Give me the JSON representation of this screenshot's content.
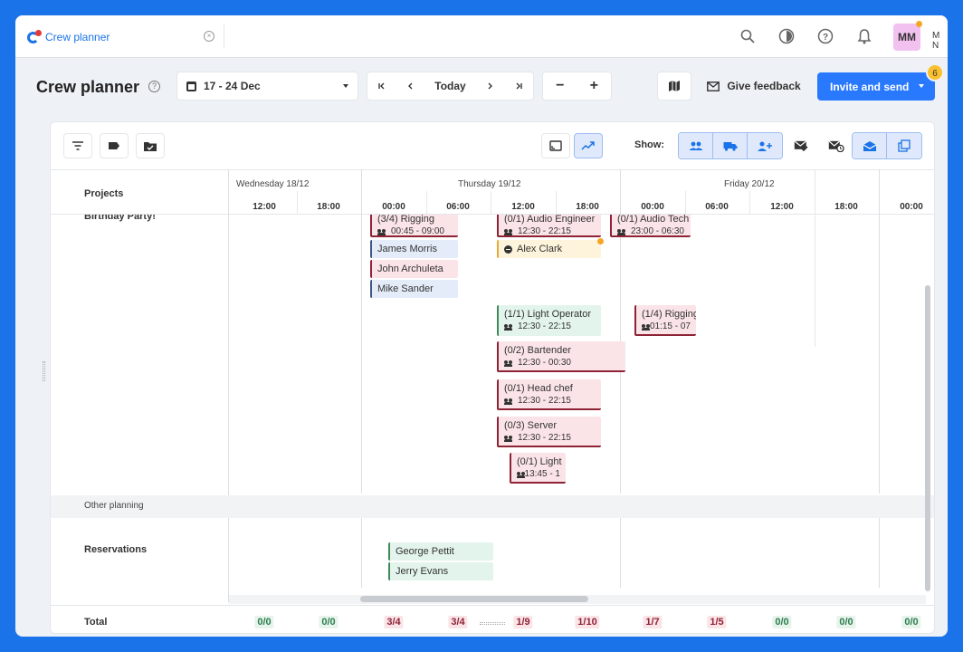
{
  "tab": {
    "title": "Crew planner"
  },
  "user": {
    "initials": "MM",
    "name": "M N"
  },
  "header": {
    "title": "Crew planner",
    "date_range": "17 - 24 Dec",
    "today": "Today",
    "minus": "−",
    "plus": "+",
    "feedback": "Give feedback",
    "invite": "Invite and send",
    "badge": "6"
  },
  "toolbar": {
    "show_label": "Show:"
  },
  "grid": {
    "projects_header": "Projects",
    "days": [
      "Wednesday 18/12",
      "Thursday 19/12",
      "Friday 20/12"
    ],
    "times": [
      "12:00",
      "18:00",
      "00:00",
      "06:00",
      "12:00",
      "18:00",
      "00:00",
      "06:00",
      "12:00",
      "18:00",
      "00:00"
    ]
  },
  "projects": {
    "birthday": "Birthday Party!",
    "other_planning": "Other planning",
    "reservations": "Reservations"
  },
  "cards": {
    "rigging1": {
      "title": "(3/4) Rigging",
      "time": "00:45 - 09:00"
    },
    "audio_engineer": {
      "title": "(0/1) Audio Engineer",
      "time": "12:30 - 22:15"
    },
    "audio_tech": {
      "title": "(0/1) Audio Tech",
      "time": "23:00 - 06:30"
    },
    "james": "James Morris",
    "john": "John Archuleta",
    "mike": "Mike Sander",
    "alex": "Alex Clark",
    "light_operator": {
      "title": "(1/1) Light Operator",
      "time": "12:30 - 22:15"
    },
    "rigging2": {
      "title": "(1/4) Rigging",
      "time": "01:15 - 07"
    },
    "bartender": {
      "title": "(0/2) Bartender",
      "time": "12:30 - 00:30"
    },
    "head_chef": {
      "title": "(0/1) Head chef",
      "time": "12:30 - 22:15"
    },
    "server": {
      "title": "(0/3) Server",
      "time": "12:30 - 22:15"
    },
    "light": {
      "title": "(0/1) Light",
      "time": "13:45 - 1"
    },
    "george": "George Pettit",
    "jerry": "Jerry Evans"
  },
  "totals": {
    "label": "Total",
    "values": [
      "0/0",
      "0/0",
      "3/4",
      "3/4",
      "1/9",
      "1/10",
      "1/7",
      "1/5",
      "0/0",
      "0/0",
      "0/0"
    ],
    "status": [
      "ok",
      "ok",
      "bad",
      "bad",
      "bad",
      "bad",
      "bad",
      "bad",
      "ok",
      "ok",
      "ok"
    ]
  },
  "colors": {
    "accent": "#2979ff",
    "background": "#1a73e8",
    "under_staffed": "#8e2335",
    "staffed": "#3e8a5c"
  }
}
